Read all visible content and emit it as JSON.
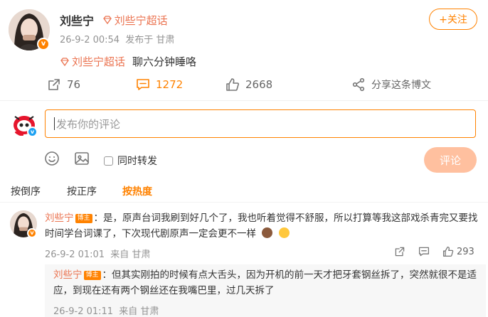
{
  "post": {
    "author": "刘些宁",
    "topic": "刘些宁超话",
    "time": "26-9-2 00:54",
    "source": "发布于 甘肃",
    "follow_label": "+关注",
    "content_topic": "刘些宁超话",
    "content_text": "聊六分钟睡咯"
  },
  "actions": {
    "repost_count": "76",
    "comment_count": "1272",
    "like_count": "2668",
    "share_label": "分享这条博文"
  },
  "composer": {
    "placeholder": "发布你的评论",
    "repost_label": "同时转发",
    "submit_label": "评论"
  },
  "sort": {
    "options": [
      "按倒序",
      "按正序",
      "按热度"
    ],
    "active": "按热度"
  },
  "comments": [
    {
      "author": "刘些宁",
      "badge": "博主",
      "text": "：是，原声台词我刷到好几个了，我也听着觉得不舒服，所以打算等我这部戏杀青完又要找时间学台词课了，下次现代剧原声一定会更不一样",
      "time": "26-9-2 01:01",
      "location": "来自 甘肃",
      "like_count": "293"
    }
  ],
  "reply": {
    "author": "刘些宁",
    "badge": "博主",
    "text": "：但其实刚拍的时候有点大舌头，因为开机的前一天才把牙套钢丝拆了，突然就很不是适应，到现在还有两个钢丝还在我嘴巴里，过几天拆了",
    "time": "26-9-2 01:11",
    "location": "来自 甘肃"
  },
  "colors": {
    "brand_orange": "#ff8200",
    "link_orange": "#eb7350",
    "muted": "#939393"
  },
  "icons": [
    "repost-icon",
    "comment-icon",
    "like-icon",
    "share-icon",
    "emoji-icon",
    "image-icon",
    "diamond-icon",
    "verified-icon"
  ]
}
